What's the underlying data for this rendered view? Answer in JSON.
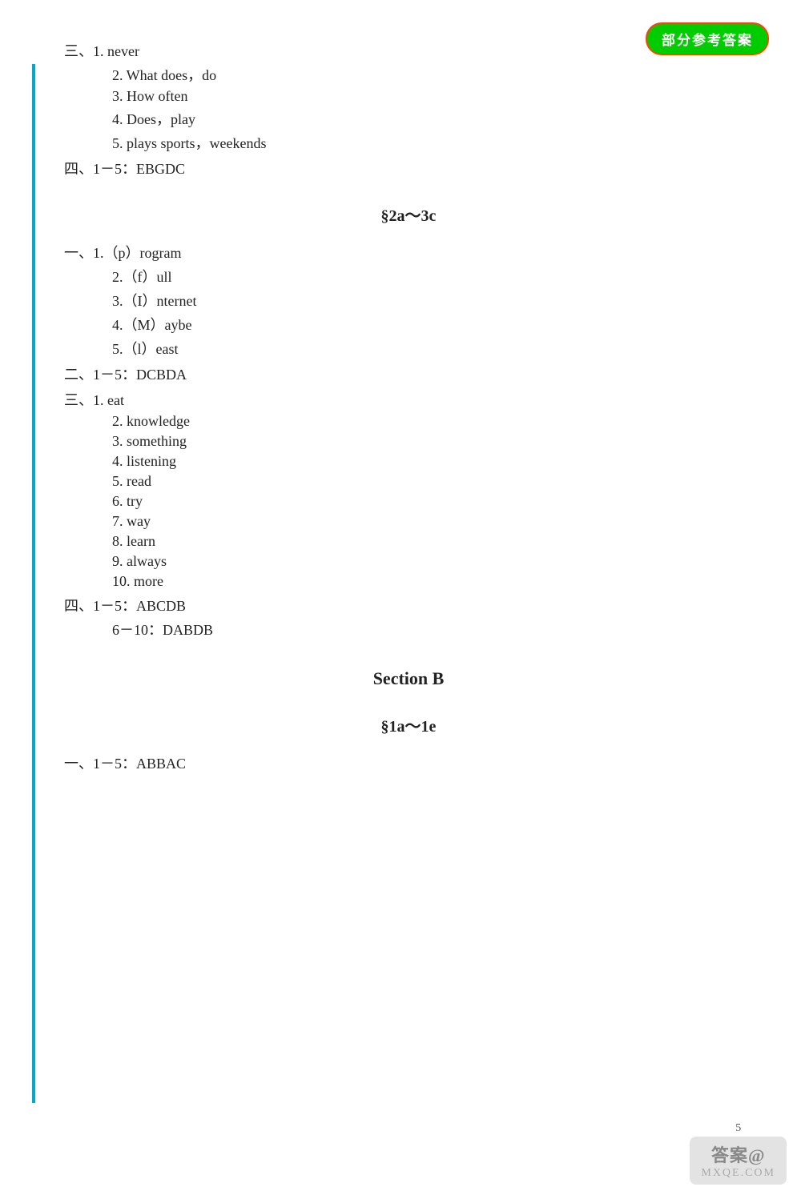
{
  "badge": {
    "label": "部分参考答案"
  },
  "section1": {
    "groups": [
      {
        "id": "san1",
        "title": "三、",
        "items": [
          "1. never",
          "2. What does，do",
          "3. How often",
          "4. Does，play",
          "5. plays sports，weekends"
        ]
      },
      {
        "id": "si1",
        "title": "四、1－5：EBGDC",
        "items": []
      }
    ]
  },
  "section2a3c": {
    "header": "§2a～3c",
    "groups": [
      {
        "id": "yi2",
        "title": "一、",
        "items": [
          "1.（p）rogram",
          "2.（f）ull",
          "3.（I）nternet",
          "4.（M）aybe",
          "5.（l）east"
        ]
      },
      {
        "id": "er2",
        "title": "二、1－5：DCBDA",
        "items": []
      },
      {
        "id": "san2",
        "title": "三、",
        "items": [
          "1. eat",
          "2. knowledge",
          "3. something",
          "4. listening",
          "5. read",
          "6. try",
          "7. way",
          "8. learn",
          "9. always",
          "10. more"
        ]
      },
      {
        "id": "si2",
        "title": "四、1－5：ABCDB",
        "items": [
          "6－10：DABDB"
        ]
      }
    ]
  },
  "sectionB": {
    "header": "Section B",
    "sub_header": "§1a～1e",
    "groups": [
      {
        "id": "yi3",
        "title": "一、1－5：ABBAC",
        "items": []
      }
    ]
  },
  "watermark": {
    "number": "5",
    "text1": "答案@",
    "text2": "MXQE.COM"
  }
}
